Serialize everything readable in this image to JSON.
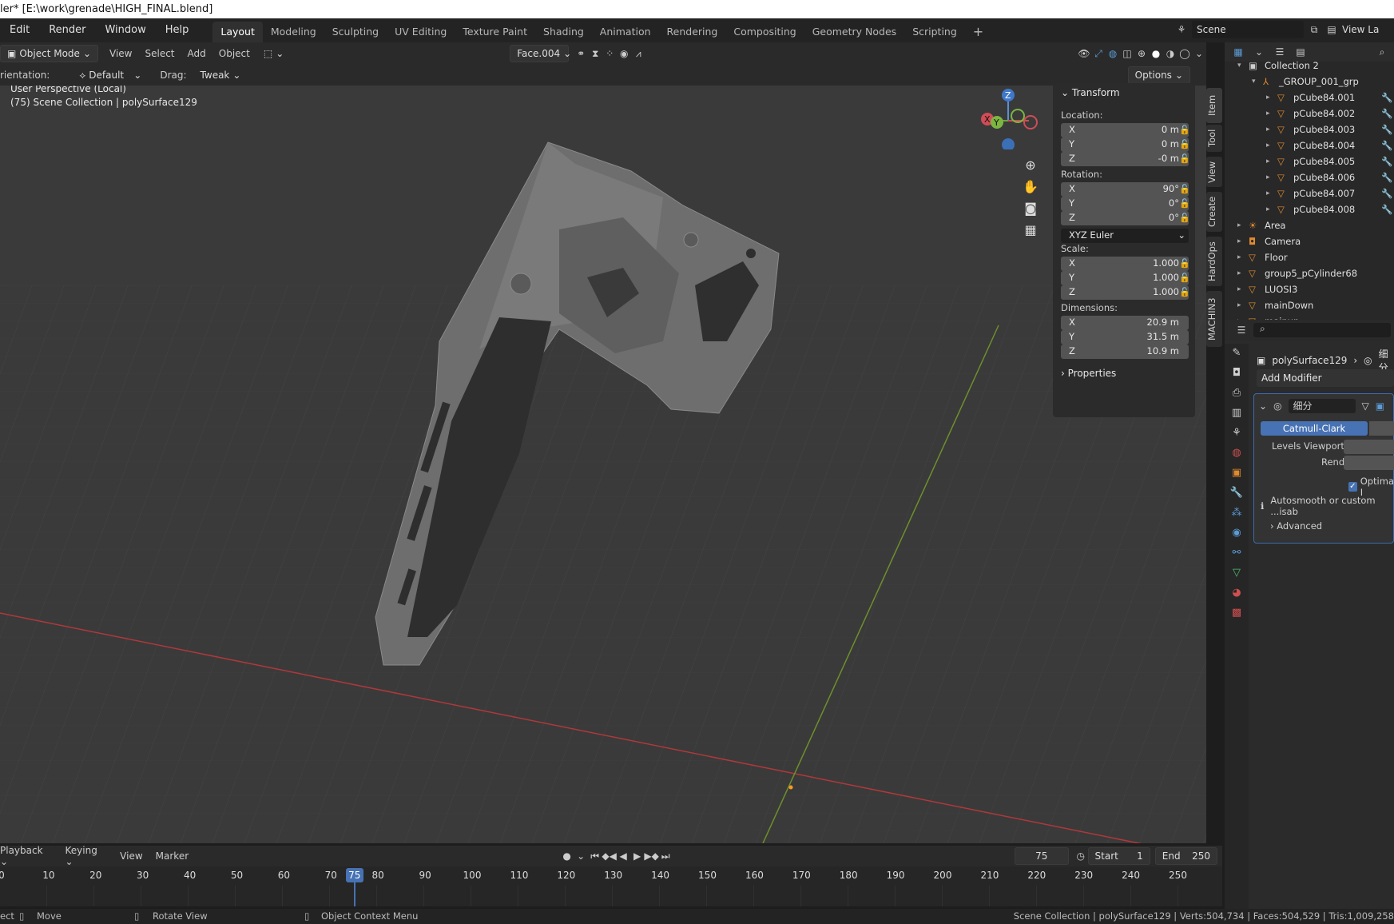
{
  "title_bar": "ler* [E:\\work\\grenade\\HIGH_FINAL.blend]",
  "menu": [
    "Edit",
    "Render",
    "Window",
    "Help"
  ],
  "workspaces": [
    "Layout",
    "Modeling",
    "Sculpting",
    "UV Editing",
    "Texture Paint",
    "Shading",
    "Animation",
    "Rendering",
    "Compositing",
    "Geometry Nodes",
    "Scripting"
  ],
  "active_workspace": "Layout",
  "add_workspace": "+",
  "scene_name": "Scene",
  "view_layer": "View La",
  "header": {
    "mode": "Object Mode",
    "view": "View",
    "select": "Select",
    "add": "Add",
    "object": "Object",
    "face_selector": "Face.004",
    "options": "Options"
  },
  "header3": {
    "orientation_label": "rientation:",
    "orientation_value": "Default",
    "drag_label": "Drag:",
    "drag_value": "Tweak"
  },
  "viewport": {
    "perspective": "User Perspective (Local)",
    "collection": "(75) Scene Collection | polySurface129",
    "gizmo": {
      "z": "Z",
      "y": "Y",
      "x": "X"
    }
  },
  "n_panel": {
    "transform": "Transform",
    "location_label": "Location:",
    "location": [
      {
        "axis": "X",
        "value": "0 m"
      },
      {
        "axis": "Y",
        "value": "0 m"
      },
      {
        "axis": "Z",
        "value": "-0 m"
      }
    ],
    "rotation_label": "Rotation:",
    "rotation": [
      {
        "axis": "X",
        "value": "90°"
      },
      {
        "axis": "Y",
        "value": "0°"
      },
      {
        "axis": "Z",
        "value": "0°"
      }
    ],
    "rotation_mode": "XYZ Euler",
    "scale_label": "Scale:",
    "scale": [
      {
        "axis": "X",
        "value": "1.000"
      },
      {
        "axis": "Y",
        "value": "1.000"
      },
      {
        "axis": "Z",
        "value": "1.000"
      }
    ],
    "dimensions_label": "Dimensions:",
    "dimensions": [
      {
        "axis": "X",
        "value": "20.9 m"
      },
      {
        "axis": "Y",
        "value": "31.5 m"
      },
      {
        "axis": "Z",
        "value": "10.9 m"
      }
    ],
    "properties": "Properties"
  },
  "side_tabs": [
    "Item",
    "Tool",
    "View",
    "Create",
    "HardOps",
    "MACHIN3"
  ],
  "outliner": {
    "rows": [
      {
        "name": "Collection 2",
        "indent": 1,
        "icon": "collection"
      },
      {
        "name": "_GROUP_001_grp",
        "indent": 2,
        "icon": "empty"
      },
      {
        "name": "pCube84.001",
        "indent": 3,
        "icon": "mesh"
      },
      {
        "name": "pCube84.002",
        "indent": 3,
        "icon": "mesh"
      },
      {
        "name": "pCube84.003",
        "indent": 3,
        "icon": "mesh"
      },
      {
        "name": "pCube84.004",
        "indent": 3,
        "icon": "mesh"
      },
      {
        "name": "pCube84.005",
        "indent": 3,
        "icon": "mesh"
      },
      {
        "name": "pCube84.006",
        "indent": 3,
        "icon": "mesh"
      },
      {
        "name": "pCube84.007",
        "indent": 3,
        "icon": "mesh"
      },
      {
        "name": "pCube84.008",
        "indent": 3,
        "icon": "mesh"
      },
      {
        "name": "Area",
        "indent": 1,
        "icon": "light"
      },
      {
        "name": "Camera",
        "indent": 1,
        "icon": "camera"
      },
      {
        "name": "Floor",
        "indent": 1,
        "icon": "mesh"
      },
      {
        "name": "group5_pCylinder68",
        "indent": 1,
        "icon": "mesh"
      },
      {
        "name": "LUOSI3",
        "indent": 1,
        "icon": "mesh"
      },
      {
        "name": "mainDown",
        "indent": 1,
        "icon": "mesh"
      },
      {
        "name": "mainup",
        "indent": 1,
        "icon": "mesh"
      }
    ]
  },
  "properties": {
    "object_name": "polySurface129",
    "object_suffix": "细分",
    "add_modifier": "Add Modifier",
    "modifier_name": "细分",
    "method": "Catmull-Clark",
    "levels_viewport": "Levels Viewport",
    "render": "Render",
    "optimal": "Optimal I",
    "autosmooth": "Autosmooth or custom ...isab",
    "advanced": "Advanced"
  },
  "timeline": {
    "playback": "Playback",
    "keying": "Keying",
    "view": "View",
    "marker": "Marker",
    "current_frame": "75",
    "start_label": "Start",
    "start": "1",
    "end_label": "End",
    "end": "250",
    "ticks": [
      "0",
      "10",
      "20",
      "30",
      "40",
      "50",
      "60",
      "70",
      "80",
      "90",
      "100",
      "110",
      "120",
      "130",
      "140",
      "150",
      "160",
      "170",
      "180",
      "190",
      "200",
      "210",
      "220",
      "230",
      "240",
      "250"
    ],
    "playhead": "75"
  },
  "status": {
    "left1": "ect",
    "move": "Move",
    "rotate": "Rotate View",
    "context": "Object Context Menu",
    "right": "Scene Collection | polySurface129 | Verts:504,734 | Faces:504,529 | Tris:1,009,258"
  }
}
